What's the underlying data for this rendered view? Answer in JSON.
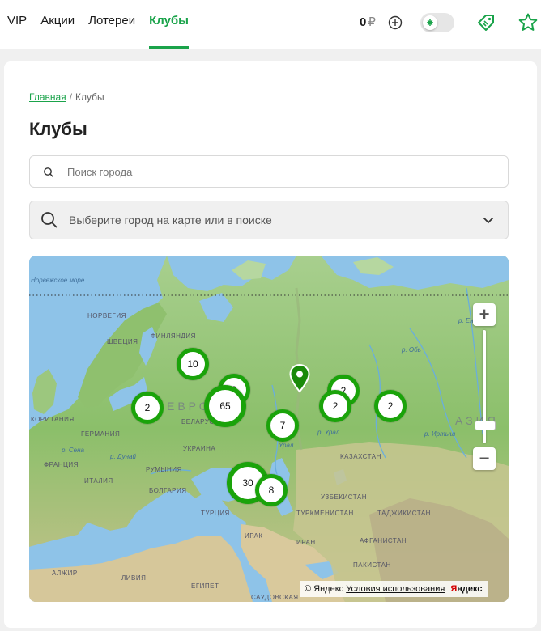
{
  "nav": {
    "items": [
      {
        "label": "VIP"
      },
      {
        "label": "Акции"
      },
      {
        "label": "Лотереи"
      },
      {
        "label": "Клубы"
      }
    ]
  },
  "header": {
    "balance": "0",
    "currency": "₽"
  },
  "breadcrumb": {
    "home": "Главная",
    "separator": "/",
    "current": "Клубы"
  },
  "page_title": "Клубы",
  "search": {
    "placeholder": "Поиск города"
  },
  "city_select": {
    "value": "Выберите город на карте или в поиске"
  },
  "map": {
    "labels": {
      "norwegian_sea": "Норвежское море",
      "norway": "НОРВЕГИЯ",
      "finland": "ФИНЛЯНДИЯ",
      "sweden": "ШВЕЦИЯ",
      "belarus": "БЕЛАРУСЬ",
      "britain": "КОРИТАНИЯ",
      "germany": "ГЕРМАНИЯ",
      "france": "ФРАНЦИЯ",
      "ukraine": "УКРАИНА",
      "romania": "РУМЫНИЯ",
      "italy": "ИТАЛИЯ",
      "bulgaria": "БОЛГАРИЯ",
      "turkey": "ТУРЦИЯ",
      "kazakhstan": "КАЗАХСТАН",
      "uzbekistan": "УЗБЕКИСТАН",
      "turkmenistan": "ТУРКМЕНИСТАН",
      "tajikistan": "ТАДЖИКИСТАН",
      "iran": "ИРАН",
      "iraq": "ИРАК",
      "afghanistan": "АФГАНИСТАН",
      "pakistan": "ПАКИСТАН",
      "algeria": "АЛЖИР",
      "libya": "ЛИВИЯ",
      "egypt": "ЕГИПЕТ",
      "saudi": "САУДОВСКАЯ",
      "evro": "ЕВРО",
      "asia": "АЗИЯ",
      "river_ural": "р. Урал",
      "river_ob": "р. Обь",
      "river_irtysh": "р. Иртыш",
      "river_ural2": "Урал",
      "river_seine": "р. Сена",
      "river_dunai": "р. Дунай",
      "river_enisei": "р. Енисей"
    },
    "clusters": [
      {
        "count": "10"
      },
      {
        "count": "2"
      },
      {
        "count": "65"
      },
      {
        "count": "7"
      },
      {
        "count": "2"
      },
      {
        "count": "2"
      },
      {
        "count": "2"
      },
      {
        "count": "30"
      },
      {
        "count": "8"
      }
    ],
    "attribution": {
      "copyright": "© Яндекс",
      "terms": "Условия использования",
      "logo_first": "Я",
      "logo_rest": "ндекс"
    }
  },
  "colors": {
    "accent": "#1aa34a",
    "cluster": "#1aa30a",
    "land": "#8bbf6a",
    "water": "#8ec3e8"
  }
}
